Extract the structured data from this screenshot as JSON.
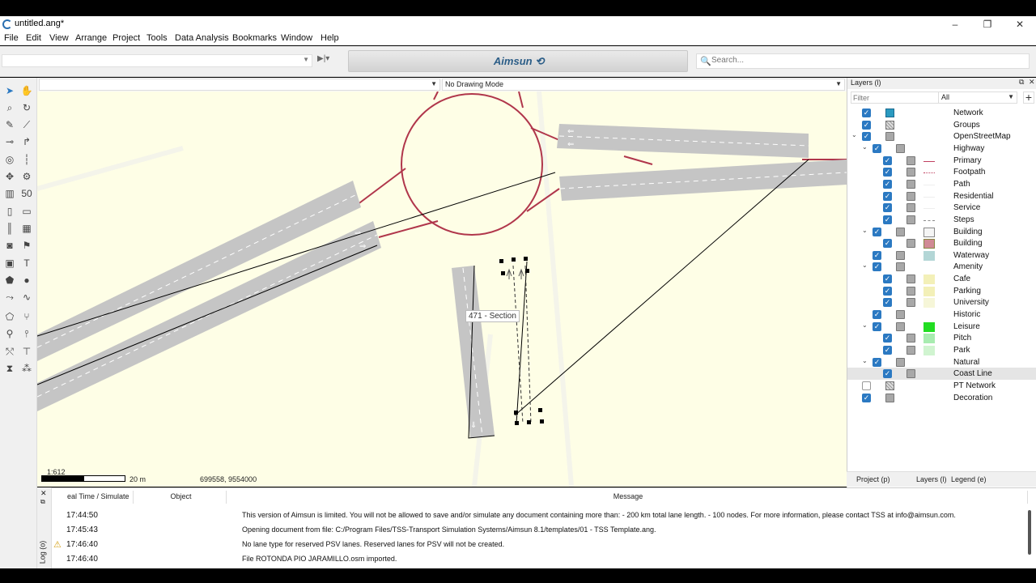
{
  "window": {
    "title": "untitled.ang*",
    "min": "–",
    "max": "❐",
    "close": "✕"
  },
  "menu": [
    "File",
    "Edit",
    "View",
    "Arrange",
    "Project",
    "Tools",
    "Data Analysis",
    "Bookmarks",
    "Window",
    "Help"
  ],
  "toolbar": {
    "brand": "Aimsun",
    "search_placeholder": "Search..."
  },
  "drawing": {
    "mode": "No Drawing Mode",
    "layer": ""
  },
  "canvas": {
    "tooltip": "471 - Section",
    "scale": "1:612",
    "scale_distance": "20 m",
    "coordinates": "699558, 9554000"
  },
  "layers_panel": {
    "title": "Layers (l)",
    "filter_placeholder": "Filter",
    "type_filter": "All",
    "add": "+",
    "layers": [
      {
        "label": "Network",
        "checked": true,
        "symbol": "network-blue"
      },
      {
        "label": "Groups",
        "checked": true,
        "symbol": "grid"
      },
      {
        "label": "OpenStreetMap",
        "checked": true,
        "expand": true
      },
      {
        "label": "Highway",
        "checked": true,
        "expand": true
      },
      {
        "label": "Primary",
        "checked": true,
        "symbol": "line-red"
      },
      {
        "label": "Footpath",
        "checked": true,
        "symbol": "dots-red"
      },
      {
        "label": "Path",
        "checked": true,
        "symbol": "line-pale"
      },
      {
        "label": "Residential",
        "checked": true,
        "symbol": "line-pale"
      },
      {
        "label": "Service",
        "checked": true,
        "symbol": "line-pale"
      },
      {
        "label": "Steps",
        "checked": true,
        "symbol": "dash-gray"
      },
      {
        "label": "Building",
        "checked": true,
        "expand": true,
        "symbol": "box-white"
      },
      {
        "label": "Building",
        "checked": true,
        "symbol": "box-pink"
      },
      {
        "label": "Waterway",
        "checked": true,
        "symbol": "fill-teal"
      },
      {
        "label": "Amenity",
        "checked": true,
        "expand": true
      },
      {
        "label": "Cafe",
        "checked": true,
        "symbol": "fill-yellow"
      },
      {
        "label": "Parking",
        "checked": true,
        "symbol": "fill-yellow"
      },
      {
        "label": "University",
        "checked": true,
        "symbol": "fill-paleyellow"
      },
      {
        "label": "Historic",
        "checked": true
      },
      {
        "label": "Leisure",
        "checked": true,
        "expand": true,
        "symbol": "fill-green"
      },
      {
        "label": "Pitch",
        "checked": true,
        "symbol": "fill-lightgreen"
      },
      {
        "label": "Park",
        "checked": true,
        "symbol": "fill-palegreen"
      },
      {
        "label": "Natural",
        "checked": true,
        "expand": true
      },
      {
        "label": "Coast Line",
        "checked": true,
        "highlight": true
      },
      {
        "label": "PT Network",
        "checked": false,
        "symbol": "grid"
      },
      {
        "label": "Decoration",
        "checked": true
      }
    ],
    "tabs": [
      "Project (p)",
      "Layers (l)",
      "Legend (e)"
    ]
  },
  "log": {
    "side_label": "Log (o)",
    "columns": [
      "eal Time / Simulate",
      "Object",
      "Message"
    ],
    "rows": [
      {
        "time": "17:44:50",
        "warn": false,
        "message": "This version of Aimsun is limited. You will not be allowed to save and/or simulate any document containing more than: - 200 km total lane length. - 100 nodes. For more information, please contact TSS at info@aimsun.com."
      },
      {
        "time": "17:45:43",
        "warn": false,
        "message": "Opening document from file: C:/Program Files/TSS-Transport Simulation Systems/Aimsun 8.1/templates/01 - TSS Template.ang."
      },
      {
        "time": "17:46:40",
        "warn": true,
        "message": "No lane type for reserved PSV lanes. Reserved lanes for PSV will not be created."
      },
      {
        "time": "17:46:40",
        "warn": false,
        "message": "File ROTONDA PIO JARAMILLO.osm imported."
      }
    ]
  },
  "colors": {
    "canvas_bg": "#fefee6",
    "road": "#c8c8c8",
    "primary_road": "#b0364b",
    "checkbox": "#2b79c2"
  }
}
